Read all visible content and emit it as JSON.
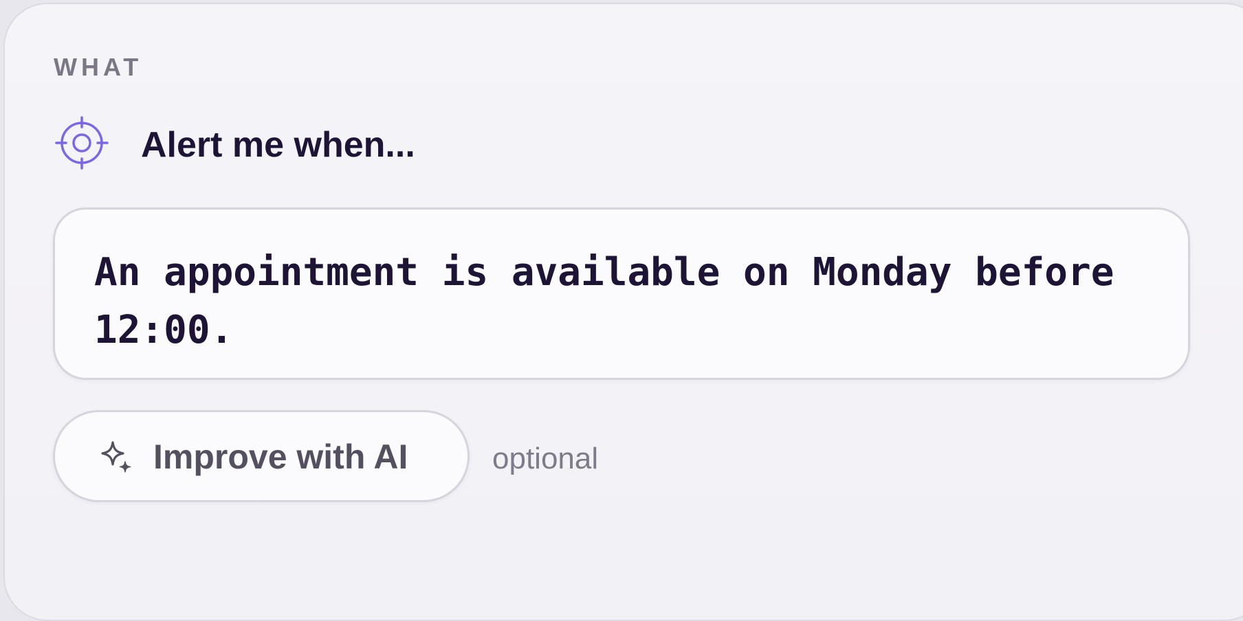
{
  "section": {
    "label": "WHAT"
  },
  "alert": {
    "icon": "target-icon",
    "heading": "Alert me when...",
    "condition_text": "An appointment is available on Monday before 12:00."
  },
  "improve": {
    "icon": "sparkle-icon",
    "button_label": "Improve with AI",
    "hint": "optional"
  },
  "colors": {
    "accent": "#7b67e6",
    "text_dark": "#1d1436",
    "text_muted": "#7b7784"
  }
}
